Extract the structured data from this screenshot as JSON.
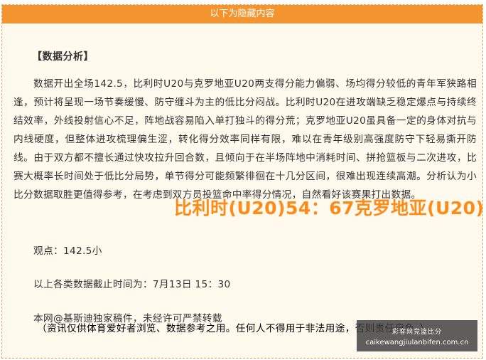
{
  "header": {
    "title": "以下为隐藏内容"
  },
  "content": {
    "section_title": "【数据分析】",
    "analysis_paragraph": "数据开出全场142.5，比利时U20与克罗地亚U20两支得分能力偏弱、场均得分较低的青年军狭路相逢，预计将呈现一场节奏缓慢、防守缠斗为主的低比分闷战。比利时U20在进攻端缺乏稳定爆点与持续终结效率，外线投射信心不足，阵地战容易陷入单打独斗的得分荒；克罗地亚U20虽具备一定的身体对抗与内线硬度，但整体进攻梳理偏生涩，转化得分效率同样有限，难以在青年级别高强度防守下轻易撕开防线。由于双方都不擅长通过快攻拉升回合数，且倾向于在半场阵地中消耗时间、拼抢篮板与二次进攻，比赛大概率长时间处于低比分局势，单节得分可能频繁徘徊在十几分区间，很难出现连续高潮。分析认为小比分数据取胜更值得参考，在考虑到双方员投篮命中率得分情况，自然看好该赛果打出数据。",
    "score_overlay": "比利时(U20)54：67克罗地亚(U20)",
    "viewpoint": "观点：142.5小",
    "data_cutoff": "以上各类数据截止时间为：7月13日 15：30",
    "copyright": "本网@基斯迪独家稿件，未经许可严禁转载",
    "disclaimer": "（资讯仅供体育爱好者浏览、数据参考之用。任何人不得用于非法用途，否则责任自负。）"
  },
  "watermark": {
    "title": "彩客网竞篮比分",
    "url": "caikewangjiulanbifen.com.cn"
  },
  "colors": {
    "header_bg": "#f3942f",
    "frame_bg": "#fff9ee",
    "score_overlay": "#ff8a16",
    "body_text": "#333333"
  }
}
